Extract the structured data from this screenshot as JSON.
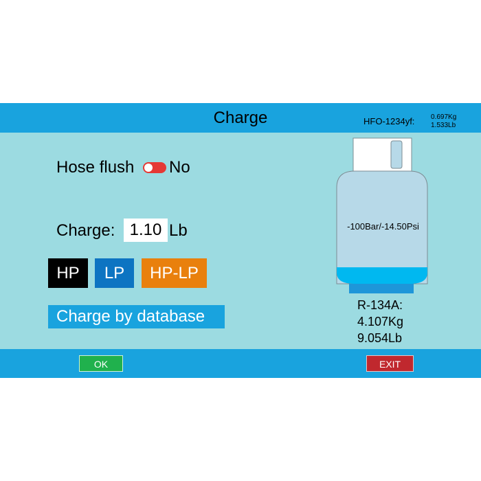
{
  "header": {
    "title": "Charge",
    "refrigerant_name": "HFO-1234yf:",
    "refrigerant_kg": "0.697Kg",
    "refrigerant_lb": "1.533Lb"
  },
  "hose_flush": {
    "label": "Hose flush",
    "value": "No",
    "enabled": false
  },
  "charge": {
    "label": "Charge:",
    "value": "1.10",
    "unit": "Lb"
  },
  "mode_buttons": {
    "hp": "HP",
    "lp": "LP",
    "hp_lp": "HP-LP"
  },
  "database_button": "Charge by database",
  "tank": {
    "pressure": "-100Bar/-14.50Psi",
    "refrigerant": "R-134A:",
    "weight_kg": "4.107Kg",
    "weight_lb": "9.054Lb"
  },
  "footer": {
    "ok_label": "OK",
    "exit_label": "EXIT"
  },
  "colors": {
    "bar": "#19a3de",
    "background": "#9cdbe1",
    "ok": "#20b14d",
    "exit": "#c0282e",
    "toggle_off": "#e53935",
    "hp": "#000000",
    "lp": "#0d74c2",
    "hp_lp": "#e9800d",
    "tank_body": "#b7d9e8",
    "tank_liquid": "#00b8f0"
  }
}
